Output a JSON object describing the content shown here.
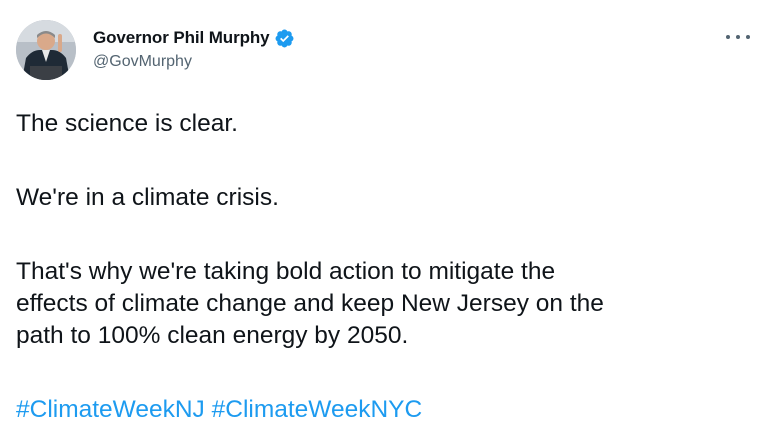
{
  "tweet": {
    "author": {
      "display_name": "Governor Phil Murphy",
      "handle": "@GovMurphy",
      "verified": true,
      "avatar_icon": "person-at-podium-avatar",
      "verified_icon": "verified-badge-icon"
    },
    "more_icon": "more-options-icon",
    "text": {
      "line1": "The science is clear.",
      "line2": "We're in a climate crisis.",
      "line3": "That's why we're taking bold action to mitigate the",
      "line4": "effects of climate change and keep New Jersey on the",
      "line5": "path to 100% clean energy by 2050."
    },
    "hashtags": [
      "#ClimateWeekNJ",
      "#ClimateWeekNYC"
    ]
  },
  "colors": {
    "text": "#0f1419",
    "secondary": "#536471",
    "link": "#1d9bf0",
    "verified": "#1d9bf0"
  }
}
